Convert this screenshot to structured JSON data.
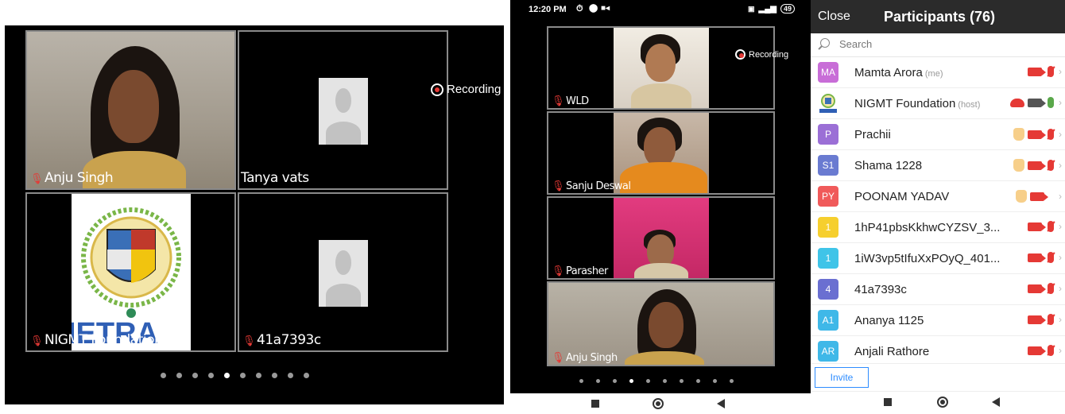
{
  "left_gallery": {
    "recording_label": "Recording",
    "tiles": [
      {
        "name": "Anju Singh"
      },
      {
        "name": "Tanya vats"
      },
      {
        "name": "NIGMT Foundation"
      },
      {
        "name": "41a7393c"
      }
    ],
    "logo_text": "IETRA",
    "page_dots": 10,
    "active_dot": 4
  },
  "phone": {
    "status_time": "12:20 PM",
    "battery": "49",
    "recording_label": "Recording",
    "tiles": [
      {
        "name": "WLD"
      },
      {
        "name": "Sanju Deswal"
      },
      {
        "name": "Parasher"
      },
      {
        "name": "Anju Singh"
      }
    ],
    "page_dots": 10,
    "active_dot": 3
  },
  "participants_panel": {
    "close_label": "Close",
    "title": "Participants (76)",
    "search_placeholder": "Search",
    "invite_label": "Invite",
    "participants": [
      {
        "initials": "MA",
        "name": "Mamta Arora",
        "tag": "(me)",
        "color": "#c86dd7",
        "hand": false
      },
      {
        "initials": "",
        "name": "NIGMT Foundation",
        "tag": "(host)",
        "color": "#ffffff",
        "hand": false
      },
      {
        "initials": "P",
        "name": "Prachii",
        "tag": "",
        "color": "#9b6fd6",
        "hand": true
      },
      {
        "initials": "S1",
        "name": "Shama 1228",
        "tag": "",
        "color": "#6a7bd1",
        "hand": true
      },
      {
        "initials": "PY",
        "name": "POONAM YADAV",
        "tag": "",
        "color": "#f05a5a",
        "hand": true
      },
      {
        "initials": "1",
        "name": "1hP41pbsKkhwCYZSV_3...",
        "tag": "",
        "color": "#f6cf2e",
        "hand": false
      },
      {
        "initials": "1",
        "name": "1iW3vp5tIfuXxPOyQ_401...",
        "tag": "",
        "color": "#3fc4e8",
        "hand": false
      },
      {
        "initials": "4",
        "name": "41a7393c",
        "tag": "",
        "color": "#6a6fd1",
        "hand": false
      },
      {
        "initials": "A1",
        "name": "Ananya 1125",
        "tag": "",
        "color": "#3fb8e8",
        "hand": false
      },
      {
        "initials": "AR",
        "name": "Anjali Rathore",
        "tag": "",
        "color": "#3fb8e8",
        "hand": false
      }
    ]
  }
}
